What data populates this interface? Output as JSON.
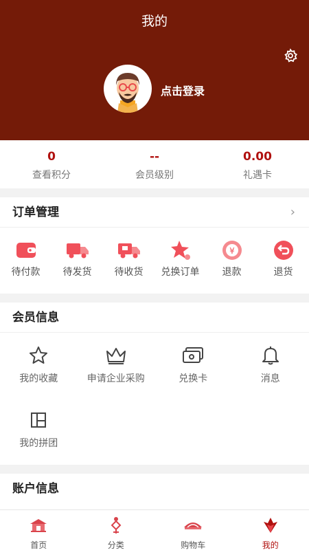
{
  "header": {
    "title": "我的",
    "login_label": "点击登录"
  },
  "stats": [
    {
      "value": "0",
      "label": "查看积分"
    },
    {
      "value": "--",
      "label": "会员级别"
    },
    {
      "value": "0.00",
      "label": "礼遇卡"
    }
  ],
  "orders": {
    "title": "订单管理",
    "items": [
      {
        "label": "待付款",
        "icon": "wallet-icon"
      },
      {
        "label": "待发货",
        "icon": "truck-icon"
      },
      {
        "label": "待收货",
        "icon": "delivery-truck-icon"
      },
      {
        "label": "兑换订单",
        "icon": "star-icon"
      },
      {
        "label": "退款",
        "icon": "refund-icon"
      },
      {
        "label": "退货",
        "icon": "return-icon"
      }
    ]
  },
  "member": {
    "title": "会员信息",
    "items": [
      {
        "label": "我的收藏",
        "icon": "star-outline-icon"
      },
      {
        "label": "申请企业采购",
        "icon": "crown-icon"
      },
      {
        "label": "兑换卡",
        "icon": "card-icon"
      },
      {
        "label": "消息",
        "icon": "bell-icon"
      },
      {
        "label": "我的拼团",
        "icon": "group-icon"
      }
    ]
  },
  "account": {
    "title": "账户信息"
  },
  "tabbar": [
    {
      "label": "首页",
      "icon": "home-icon"
    },
    {
      "label": "分类",
      "icon": "category-icon"
    },
    {
      "label": "购物车",
      "icon": "cart-icon"
    },
    {
      "label": "我的",
      "icon": "profile-icon"
    }
  ],
  "colors": {
    "header_bg": "#741b08",
    "accent": "#b0110f"
  }
}
